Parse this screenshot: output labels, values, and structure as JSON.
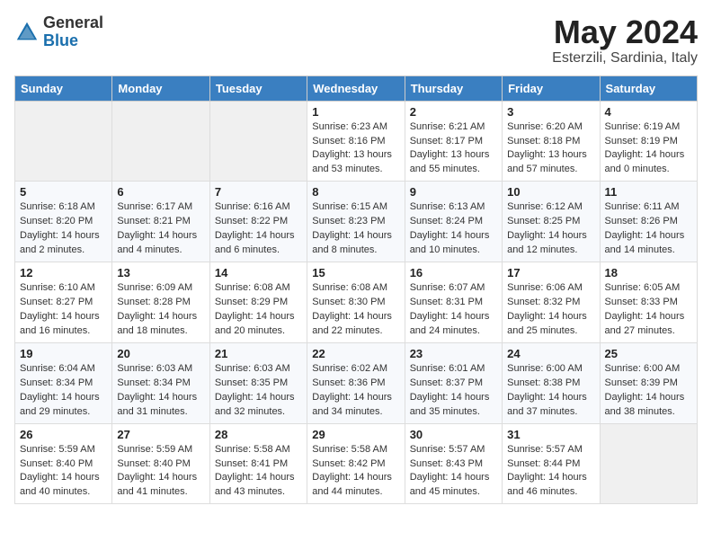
{
  "header": {
    "logo": {
      "general": "General",
      "blue": "Blue"
    },
    "title": "May 2024",
    "location": "Esterzili, Sardinia, Italy"
  },
  "calendar": {
    "days_of_week": [
      "Sunday",
      "Monday",
      "Tuesday",
      "Wednesday",
      "Thursday",
      "Friday",
      "Saturday"
    ],
    "weeks": [
      [
        {
          "day": "",
          "info": ""
        },
        {
          "day": "",
          "info": ""
        },
        {
          "day": "",
          "info": ""
        },
        {
          "day": "1",
          "info": "Sunrise: 6:23 AM\nSunset: 8:16 PM\nDaylight: 13 hours and 53 minutes."
        },
        {
          "day": "2",
          "info": "Sunrise: 6:21 AM\nSunset: 8:17 PM\nDaylight: 13 hours and 55 minutes."
        },
        {
          "day": "3",
          "info": "Sunrise: 6:20 AM\nSunset: 8:18 PM\nDaylight: 13 hours and 57 minutes."
        },
        {
          "day": "4",
          "info": "Sunrise: 6:19 AM\nSunset: 8:19 PM\nDaylight: 14 hours and 0 minutes."
        }
      ],
      [
        {
          "day": "5",
          "info": "Sunrise: 6:18 AM\nSunset: 8:20 PM\nDaylight: 14 hours and 2 minutes."
        },
        {
          "day": "6",
          "info": "Sunrise: 6:17 AM\nSunset: 8:21 PM\nDaylight: 14 hours and 4 minutes."
        },
        {
          "day": "7",
          "info": "Sunrise: 6:16 AM\nSunset: 8:22 PM\nDaylight: 14 hours and 6 minutes."
        },
        {
          "day": "8",
          "info": "Sunrise: 6:15 AM\nSunset: 8:23 PM\nDaylight: 14 hours and 8 minutes."
        },
        {
          "day": "9",
          "info": "Sunrise: 6:13 AM\nSunset: 8:24 PM\nDaylight: 14 hours and 10 minutes."
        },
        {
          "day": "10",
          "info": "Sunrise: 6:12 AM\nSunset: 8:25 PM\nDaylight: 14 hours and 12 minutes."
        },
        {
          "day": "11",
          "info": "Sunrise: 6:11 AM\nSunset: 8:26 PM\nDaylight: 14 hours and 14 minutes."
        }
      ],
      [
        {
          "day": "12",
          "info": "Sunrise: 6:10 AM\nSunset: 8:27 PM\nDaylight: 14 hours and 16 minutes."
        },
        {
          "day": "13",
          "info": "Sunrise: 6:09 AM\nSunset: 8:28 PM\nDaylight: 14 hours and 18 minutes."
        },
        {
          "day": "14",
          "info": "Sunrise: 6:08 AM\nSunset: 8:29 PM\nDaylight: 14 hours and 20 minutes."
        },
        {
          "day": "15",
          "info": "Sunrise: 6:08 AM\nSunset: 8:30 PM\nDaylight: 14 hours and 22 minutes."
        },
        {
          "day": "16",
          "info": "Sunrise: 6:07 AM\nSunset: 8:31 PM\nDaylight: 14 hours and 24 minutes."
        },
        {
          "day": "17",
          "info": "Sunrise: 6:06 AM\nSunset: 8:32 PM\nDaylight: 14 hours and 25 minutes."
        },
        {
          "day": "18",
          "info": "Sunrise: 6:05 AM\nSunset: 8:33 PM\nDaylight: 14 hours and 27 minutes."
        }
      ],
      [
        {
          "day": "19",
          "info": "Sunrise: 6:04 AM\nSunset: 8:34 PM\nDaylight: 14 hours and 29 minutes."
        },
        {
          "day": "20",
          "info": "Sunrise: 6:03 AM\nSunset: 8:34 PM\nDaylight: 14 hours and 31 minutes."
        },
        {
          "day": "21",
          "info": "Sunrise: 6:03 AM\nSunset: 8:35 PM\nDaylight: 14 hours and 32 minutes."
        },
        {
          "day": "22",
          "info": "Sunrise: 6:02 AM\nSunset: 8:36 PM\nDaylight: 14 hours and 34 minutes."
        },
        {
          "day": "23",
          "info": "Sunrise: 6:01 AM\nSunset: 8:37 PM\nDaylight: 14 hours and 35 minutes."
        },
        {
          "day": "24",
          "info": "Sunrise: 6:00 AM\nSunset: 8:38 PM\nDaylight: 14 hours and 37 minutes."
        },
        {
          "day": "25",
          "info": "Sunrise: 6:00 AM\nSunset: 8:39 PM\nDaylight: 14 hours and 38 minutes."
        }
      ],
      [
        {
          "day": "26",
          "info": "Sunrise: 5:59 AM\nSunset: 8:40 PM\nDaylight: 14 hours and 40 minutes."
        },
        {
          "day": "27",
          "info": "Sunrise: 5:59 AM\nSunset: 8:40 PM\nDaylight: 14 hours and 41 minutes."
        },
        {
          "day": "28",
          "info": "Sunrise: 5:58 AM\nSunset: 8:41 PM\nDaylight: 14 hours and 43 minutes."
        },
        {
          "day": "29",
          "info": "Sunrise: 5:58 AM\nSunset: 8:42 PM\nDaylight: 14 hours and 44 minutes."
        },
        {
          "day": "30",
          "info": "Sunrise: 5:57 AM\nSunset: 8:43 PM\nDaylight: 14 hours and 45 minutes."
        },
        {
          "day": "31",
          "info": "Sunrise: 5:57 AM\nSunset: 8:44 PM\nDaylight: 14 hours and 46 minutes."
        },
        {
          "day": "",
          "info": ""
        }
      ]
    ]
  }
}
